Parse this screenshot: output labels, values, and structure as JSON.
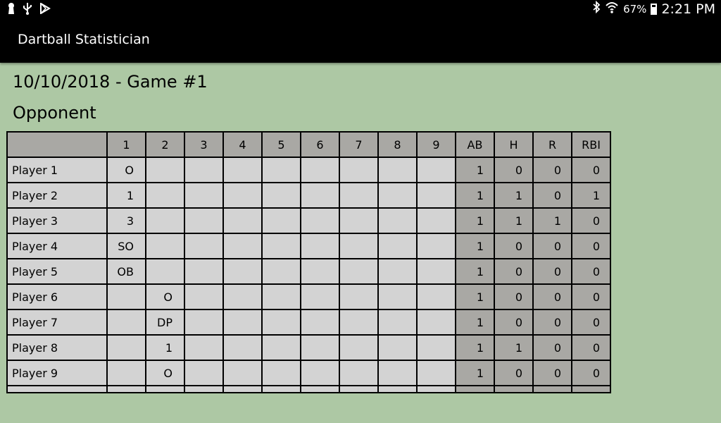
{
  "status_bar": {
    "left_icons": [
      "keyhole-icon",
      "usb-icon",
      "play-store-icon"
    ],
    "battery": "67%",
    "battery_fill": 0.67,
    "time": "2:21 PM"
  },
  "app": {
    "title": "Dartball Statistician"
  },
  "game": {
    "title": "10/10/2018 - Game #1",
    "team": "Opponent"
  },
  "scoreboard": {
    "columns": [
      "",
      "1",
      "2",
      "3",
      "4",
      "5",
      "6",
      "7",
      "8",
      "9",
      "AB",
      "H",
      "R",
      "RBI"
    ],
    "rows": [
      {
        "name": "Player 1",
        "innings": [
          "O",
          "",
          "",
          "",
          "",
          "",
          "",
          "",
          ""
        ],
        "ab": "1",
        "h": "0",
        "r": "0",
        "rbi": "0"
      },
      {
        "name": "Player 2",
        "innings": [
          "1",
          "",
          "",
          "",
          "",
          "",
          "",
          "",
          ""
        ],
        "ab": "1",
        "h": "1",
        "r": "0",
        "rbi": "1"
      },
      {
        "name": "Player 3",
        "innings": [
          "3",
          "",
          "",
          "",
          "",
          "",
          "",
          "",
          ""
        ],
        "ab": "1",
        "h": "1",
        "r": "1",
        "rbi": "0"
      },
      {
        "name": "Player 4",
        "innings": [
          "SO",
          "",
          "",
          "",
          "",
          "",
          "",
          "",
          ""
        ],
        "ab": "1",
        "h": "0",
        "r": "0",
        "rbi": "0"
      },
      {
        "name": "Player 5",
        "innings": [
          "OB",
          "",
          "",
          "",
          "",
          "",
          "",
          "",
          ""
        ],
        "ab": "1",
        "h": "0",
        "r": "0",
        "rbi": "0"
      },
      {
        "name": "Player 6",
        "innings": [
          "",
          "O",
          "",
          "",
          "",
          "",
          "",
          "",
          ""
        ],
        "ab": "1",
        "h": "0",
        "r": "0",
        "rbi": "0"
      },
      {
        "name": "Player 7",
        "innings": [
          "",
          "DP",
          "",
          "",
          "",
          "",
          "",
          "",
          ""
        ],
        "ab": "1",
        "h": "0",
        "r": "0",
        "rbi": "0"
      },
      {
        "name": "Player 8",
        "innings": [
          "",
          "1",
          "",
          "",
          "",
          "",
          "",
          "",
          ""
        ],
        "ab": "1",
        "h": "1",
        "r": "0",
        "rbi": "0"
      },
      {
        "name": "Player 9",
        "innings": [
          "",
          "O",
          "",
          "",
          "",
          "",
          "",
          "",
          ""
        ],
        "ab": "1",
        "h": "0",
        "r": "0",
        "rbi": "0"
      }
    ]
  },
  "colors": {
    "background": "#adc8a4",
    "cell": "#d3d3d3",
    "header": "#a9a8a4",
    "bar": "#000000"
  }
}
